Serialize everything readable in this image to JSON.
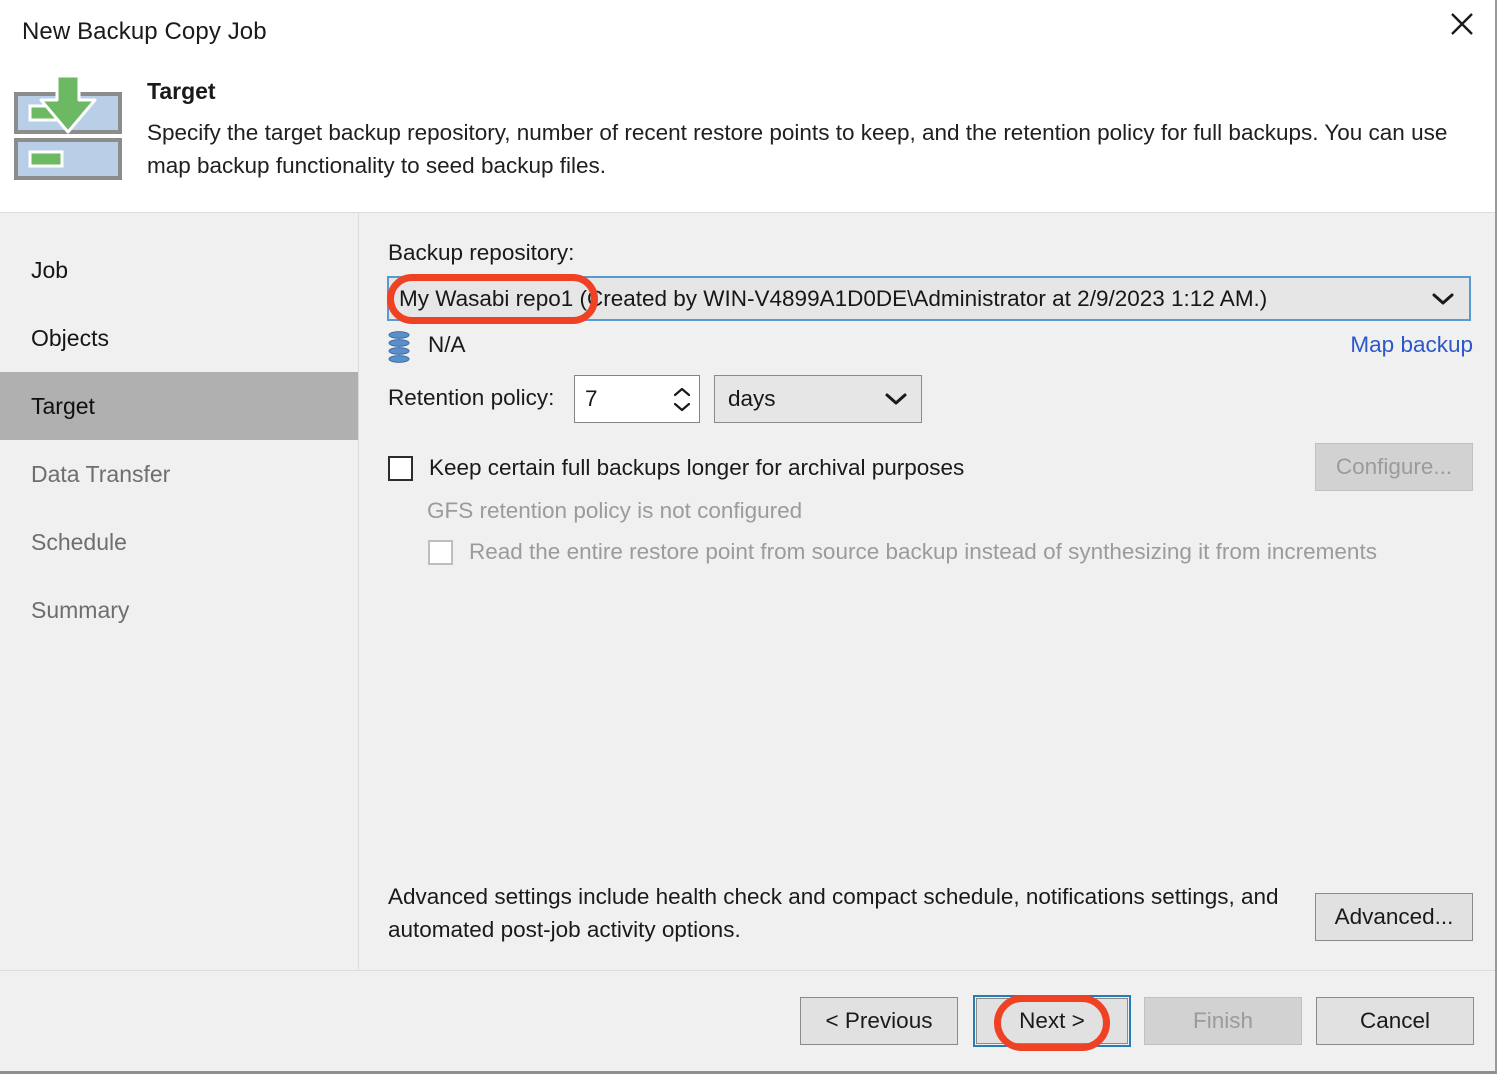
{
  "window": {
    "title": "New Backup Copy Job",
    "close_icon": "close-icon"
  },
  "header": {
    "icon": "backup-repository-download-icon",
    "title": "Target",
    "description": "Specify the target backup repository, number of recent restore points to keep, and the retention policy for full backups. You can use map backup functionality to seed backup files."
  },
  "sidebar": {
    "items": [
      {
        "label": "Job",
        "state": "done"
      },
      {
        "label": "Objects",
        "state": "done"
      },
      {
        "label": "Target",
        "state": "active"
      },
      {
        "label": "Data Transfer",
        "state": "upcoming"
      },
      {
        "label": "Schedule",
        "state": "upcoming"
      },
      {
        "label": "Summary",
        "state": "upcoming"
      }
    ]
  },
  "main": {
    "repository": {
      "label": "Backup repository:",
      "value": "My Wasabi repo1 (Created by WIN-V4899A1D0DE\\Administrator at 2/9/2023 1:12 AM.)",
      "dropdown_icon": "chevron-down-icon",
      "capacity_icon": "database-icon",
      "capacity_text": "N/A",
      "map_backup_link": "Map backup"
    },
    "retention": {
      "label": "Retention policy:",
      "value": "7",
      "spinner_icon": "spinner-up-down-icon",
      "unit": "days",
      "unit_dropdown_icon": "chevron-down-icon"
    },
    "gfs": {
      "archival_checkbox_label": "Keep certain full backups longer for archival purposes",
      "archival_checked": false,
      "note": "GFS retention policy is not configured",
      "read_full_checkbox_label": "Read the entire restore point from source backup instead of synthesizing it from increments",
      "read_full_checked": false,
      "configure_button": "Configure..."
    },
    "advanced": {
      "text": "Advanced settings include health check and compact schedule, notifications settings, and automated post-job activity options.",
      "button": "Advanced..."
    }
  },
  "footer": {
    "previous": "< Previous",
    "next": "Next >",
    "finish": "Finish",
    "cancel": "Cancel"
  },
  "annotations": {
    "color": "#ef4123",
    "highlighted": [
      "repository-value",
      "next-button"
    ]
  },
  "colors": {
    "accent_link": "#2b57c9",
    "focus_border": "#2a7ab5",
    "sidebar_active": "#b0b0b0",
    "body_background": "#f0f0f0",
    "annotation": "#ef4123",
    "icon_green": "#6cb863",
    "icon_blue": "#b9cfe8"
  }
}
